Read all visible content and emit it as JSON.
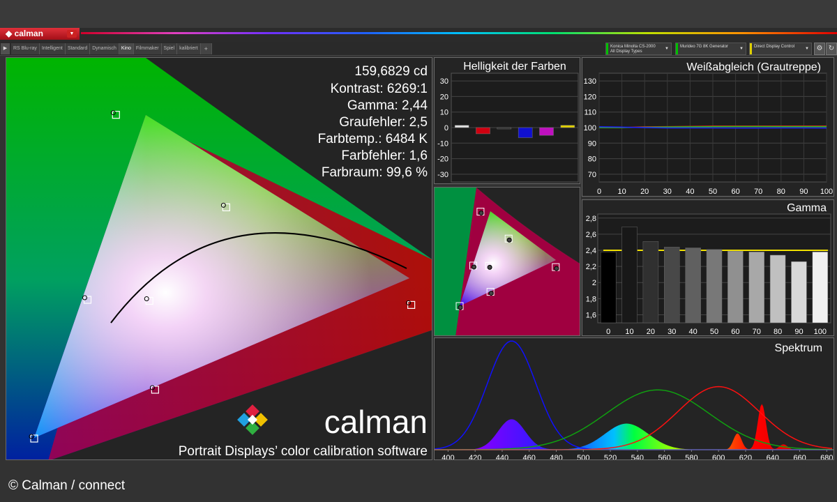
{
  "app": {
    "logo_label": "calman"
  },
  "toolbar": {
    "tabs": [
      "RS Blu-ray",
      "Intelligent",
      "Standard",
      "Dynamisch",
      "Kino",
      "Filmmaker",
      "Spiel",
      "kalibriert"
    ],
    "active_tab": "Kino",
    "devices": [
      {
        "line1": "Konica Minolta CS-2000",
        "line2": "All Display Types",
        "color": "#00c000"
      },
      {
        "line1": "Murideo 7G 8K Generator",
        "line2": "",
        "color": "#00c000"
      },
      {
        "line1": "Direct Display Control",
        "line2": "",
        "color": "#e0d000"
      }
    ]
  },
  "main_cie": {
    "stats": [
      "159,6829 cd",
      "Kontrast: 6269:1",
      "Gamma: 2,44",
      "Graufehler: 2,5",
      "Farbtemp.: 6484 K",
      "Farbfehler: 1,6",
      "Farbraum: 99,6 %"
    ],
    "brand": "calman",
    "tagline": "Portrait Displays’ color calibration software"
  },
  "credit": "© Calman / connect",
  "chart_data": [
    {
      "type": "bar",
      "title": "Helligkeit der Farben",
      "categories": [
        "White",
        "Red",
        "Green",
        "Blue",
        "Magenta",
        "Yellow"
      ],
      "values": [
        1.5,
        -4,
        -0.5,
        -6.5,
        -5,
        1.5
      ],
      "colors": [
        "#e0e0e0",
        "#d00010",
        "#2a2a2a",
        "#1010d0",
        "#c010c0",
        "#e0d000"
      ],
      "ylim": [
        -35,
        35
      ],
      "yticks": [
        30,
        20,
        10,
        0,
        -10,
        -20,
        -30
      ]
    },
    {
      "type": "line",
      "title": "Weißabgleich (Grautreppe)",
      "x": [
        0,
        10,
        20,
        30,
        40,
        50,
        60,
        70,
        80,
        90,
        100
      ],
      "series": [
        {
          "values": [
            100,
            100,
            100.5,
            100.6,
            100.8,
            101,
            101,
            101,
            101,
            101,
            101
          ],
          "color": "#e02020"
        },
        {
          "values": [
            100,
            100,
            100.2,
            100.4,
            100.5,
            100.6,
            100.7,
            100.7,
            100.6,
            100.6,
            100.6
          ],
          "color": "#20c020"
        },
        {
          "values": [
            100.5,
            100.3,
            100,
            99.8,
            99.8,
            99.8,
            99.7,
            99.7,
            99.8,
            99.8,
            99.7
          ],
          "color": "#2020ff"
        }
      ],
      "ylim": [
        65,
        135
      ],
      "yticks": [
        130,
        120,
        110,
        100,
        90,
        80,
        70
      ]
    },
    {
      "type": "scatter",
      "title": "",
      "points": [
        {
          "name": "green",
          "x": 0.265,
          "y": 0.69
        },
        {
          "name": "yellow",
          "x": 0.42,
          "y": 0.51
        },
        {
          "name": "cyan",
          "x": 0.225,
          "y": 0.33
        },
        {
          "name": "white",
          "x": 0.312,
          "y": 0.328
        },
        {
          "name": "red",
          "x": 0.68,
          "y": 0.32
        },
        {
          "name": "magenta",
          "x": 0.32,
          "y": 0.155
        },
        {
          "name": "blue",
          "x": 0.15,
          "y": 0.06
        }
      ]
    },
    {
      "type": "bar",
      "title": "Gamma",
      "categories": [
        "0",
        "10",
        "20",
        "30",
        "40",
        "50",
        "60",
        "70",
        "80",
        "90",
        "100"
      ],
      "values": [
        2.38,
        2.69,
        2.51,
        2.44,
        2.43,
        2.41,
        2.39,
        2.38,
        2.34,
        2.26,
        2.38
      ],
      "target": 2.4,
      "ylim": [
        1.5,
        2.85
      ],
      "yticks": [
        "2,8",
        "2,6",
        "2,4",
        "2,2",
        "2",
        "1,8",
        "1,6"
      ]
    },
    {
      "type": "area",
      "title": "Spektrum",
      "x_range": [
        390,
        685
      ],
      "xticks": [
        400,
        420,
        440,
        460,
        480,
        500,
        520,
        540,
        560,
        580,
        600,
        620,
        640,
        660,
        680
      ],
      "series": [
        {
          "name": "blue",
          "peak": 447,
          "width": 18,
          "amp": 1.0,
          "color": "#1010ff"
        },
        {
          "name": "green",
          "peak": 555,
          "width": 38,
          "amp": 0.55,
          "color": "#10a010"
        },
        {
          "name": "red",
          "peak": 600,
          "width": 30,
          "amp": 0.58,
          "color": "#ff1010"
        }
      ]
    }
  ]
}
